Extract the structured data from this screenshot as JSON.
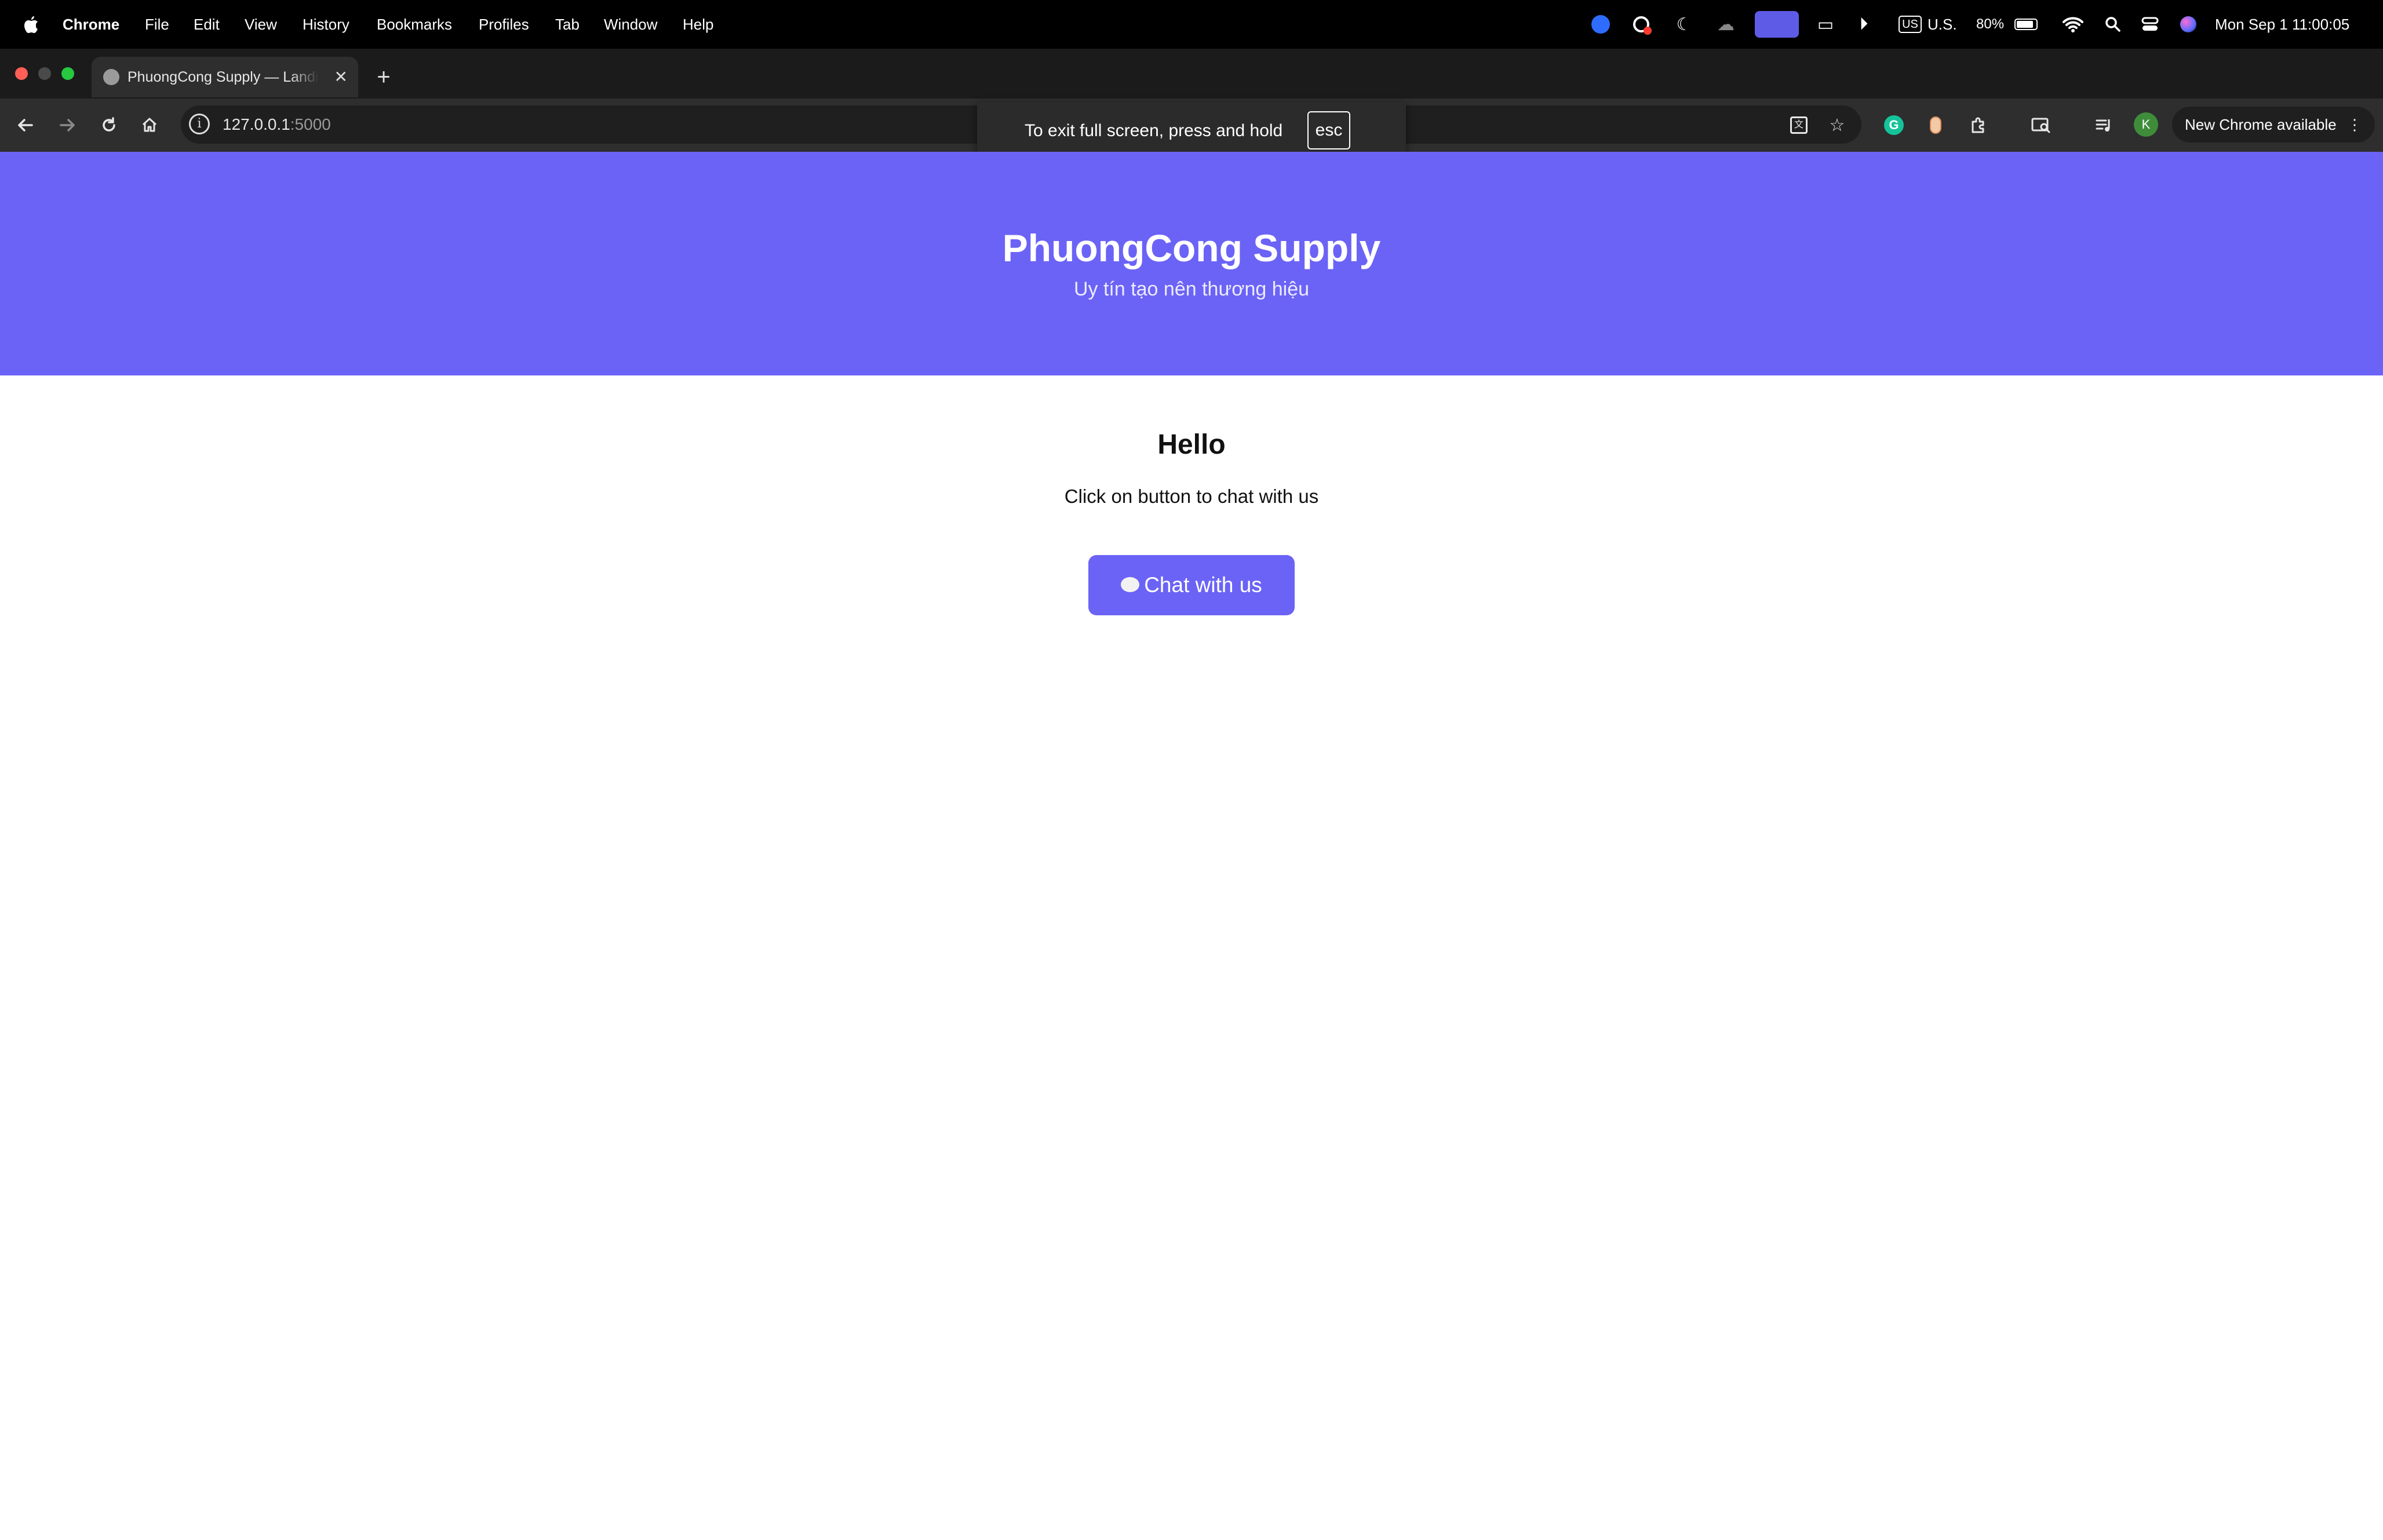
{
  "menubar": {
    "app": "Chrome",
    "items": [
      "File",
      "Edit",
      "View",
      "History",
      "Bookmarks",
      "Profiles",
      "Tab",
      "Window",
      "Help"
    ],
    "status": {
      "input_source": "U.S.",
      "input_badge": "US",
      "battery": "80%",
      "datetime": "Mon Sep 1  11:00:05"
    },
    "icons": [
      "apple-icon",
      "zoom-icon",
      "screen-record-icon",
      "moon-icon",
      "cloud-icon",
      "screen-mirroring-icon",
      "display-icon",
      "play-icon",
      "wifi-icon",
      "spotlight-icon",
      "control-center-icon",
      "siri-icon"
    ]
  },
  "tab": {
    "title": "PhuongCong Supply — Landing Page"
  },
  "toolbar": {
    "url_host": "127.0.0.1",
    "url_port": ":5000",
    "avatar_letter": "K",
    "new_chrome": "New Chrome available"
  },
  "fullscreen_bubble": {
    "message": "To exit full screen, press and hold",
    "key": "esc"
  },
  "page": {
    "site_title": "PhuongCong Supply",
    "tagline": "Uy tín tạo nên thương hiệu",
    "heading": "Hello",
    "subtext": "Click on button to chat with us",
    "chat_button": "Chat with us"
  },
  "colors": {
    "brand": "#6b63f6",
    "menubar": "#000000",
    "toolbar": "#2e2e2e"
  }
}
